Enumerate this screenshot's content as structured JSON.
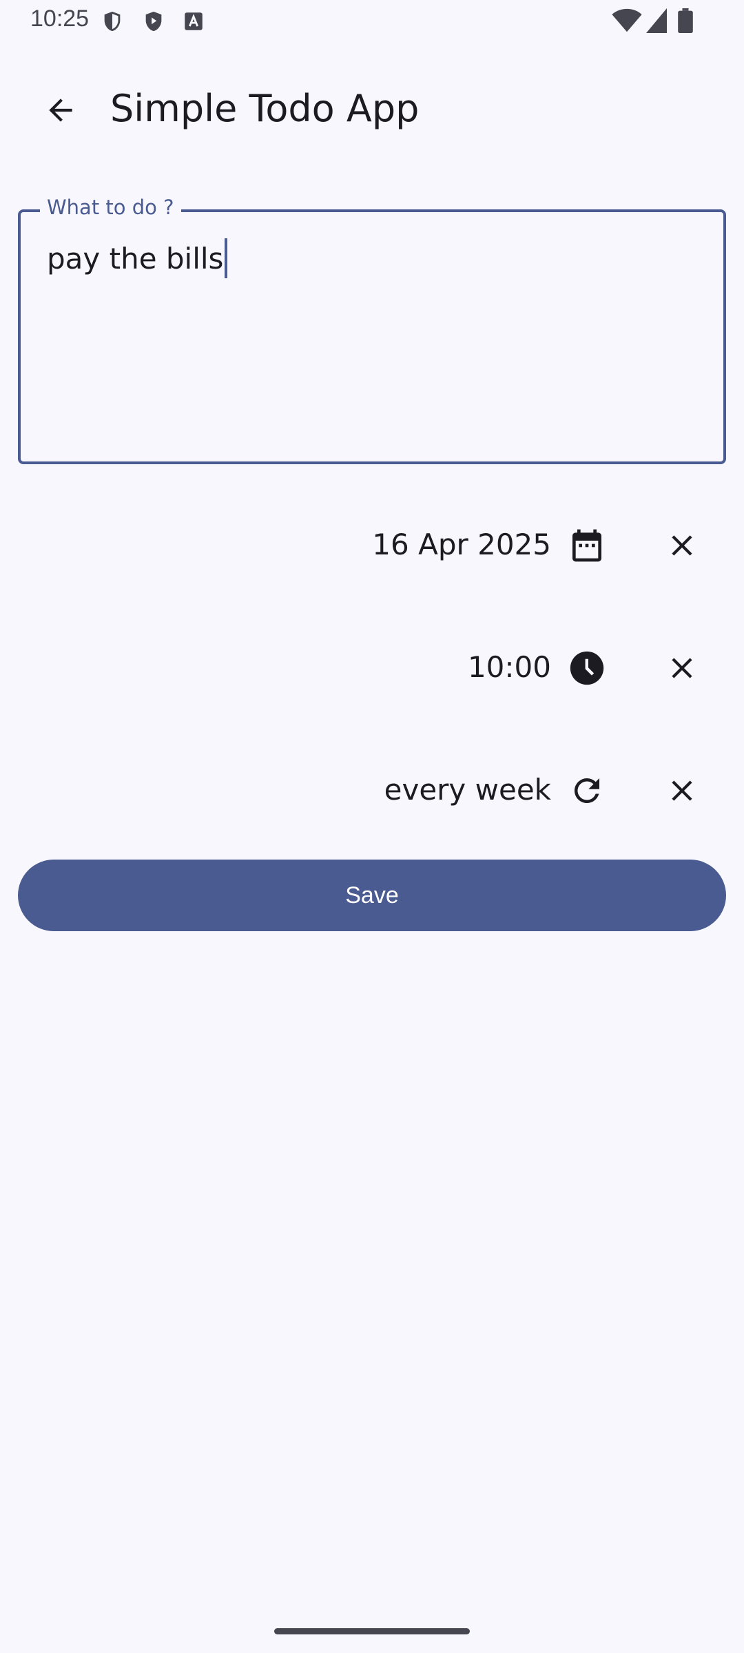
{
  "status_bar": {
    "time": "10:25"
  },
  "app_bar": {
    "title": "Simple Todo App"
  },
  "todo_field": {
    "label": "What to do ?",
    "value": "pay the bills"
  },
  "date_row": {
    "value": "16 Apr 2025",
    "icon": "calendar-icon"
  },
  "time_row": {
    "value": "10:00",
    "icon": "clock-icon"
  },
  "repeat_row": {
    "value": "every week",
    "icon": "refresh-icon"
  },
  "save_button": {
    "label": "Save"
  },
  "colors": {
    "primary": "#4a5b91",
    "background": "#f7f7fd",
    "on_surface": "#1b1b21"
  }
}
